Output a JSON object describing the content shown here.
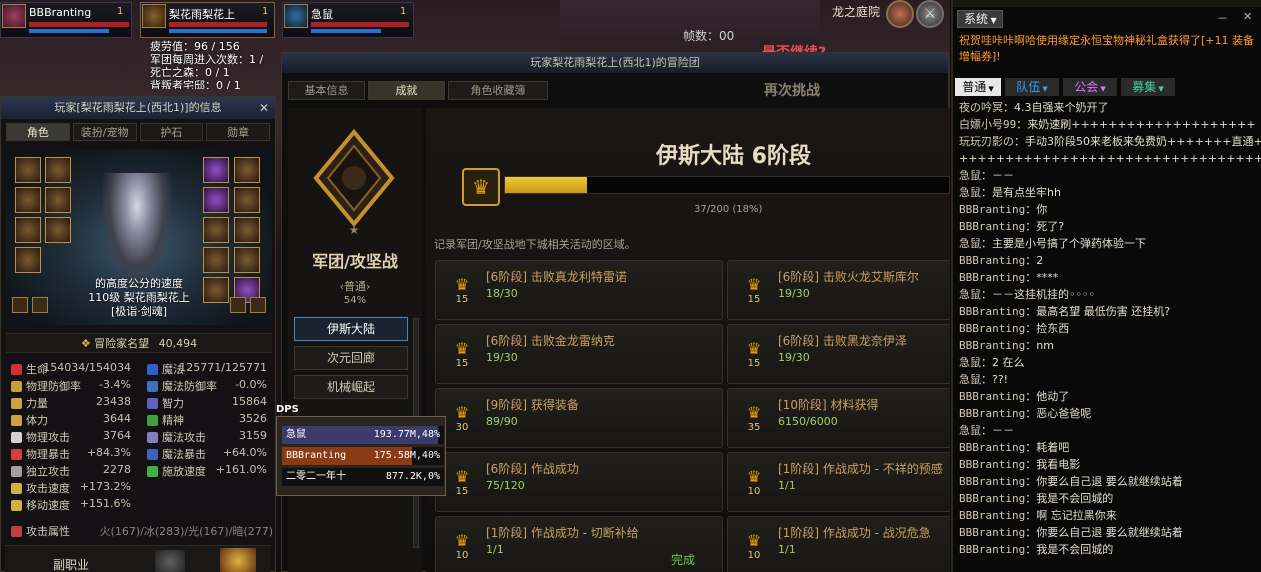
{
  "party": [
    {
      "name": "BBBranting",
      "count": "1"
    },
    {
      "name": "梨花雨梨花上",
      "count": "1"
    },
    {
      "name": "急鼠",
      "count": "1"
    }
  ],
  "location": "龙之庭院",
  "combo_label": "帧数：",
  "combo_value": "00",
  "overlay_text": "是否继续?",
  "fatigue": {
    "lines": [
      "疲劳值：96 / 156",
      "军团每周进入次数：1 /",
      "死亡之森：0 / 1",
      "背叛者宅邸：0 / 1"
    ]
  },
  "char_panel": {
    "title": "玩家[梨花雨梨花上(西北1)]的信息",
    "close": "✕",
    "tabs": [
      "角色",
      "装扮/宠物",
      "护石",
      "勋章"
    ],
    "avatar_lines": [
      "的高度公分的速度",
      "110级 梨花雨梨花上",
      "[极诣·剑魂]"
    ],
    "fame_label": "冒险家名望",
    "fame_value": "40,494",
    "stats_left": [
      {
        "label": "生命",
        "value": "154034/154034",
        "color": "#d03030"
      },
      {
        "label": "物理防御率",
        "value": "-3.4%",
        "color": "#c0a040"
      },
      {
        "label": "力量",
        "value": "23438",
        "color": "#d0a040"
      },
      {
        "label": "体力",
        "value": "3644",
        "color": "#d0a040"
      },
      {
        "label": "物理攻击",
        "value": "3764",
        "color": "#d0d0d0"
      },
      {
        "label": "物理暴击",
        "value": "+84.3%",
        "color": "#d04040"
      },
      {
        "label": "独立攻击",
        "value": "2278",
        "color": "#a0a0a0"
      },
      {
        "label": "攻击速度",
        "value": "+173.2%",
        "color": "#d0b040"
      },
      {
        "label": "移动速度",
        "value": "+151.6%",
        "color": "#d0b040"
      }
    ],
    "stats_right": [
      {
        "label": "魔法",
        "value": "125771/125771",
        "color": "#3060d0"
      },
      {
        "label": "魔法防御率",
        "value": "-0.0%",
        "color": "#4070c0"
      },
      {
        "label": "智力",
        "value": "15864",
        "color": "#6060c0"
      },
      {
        "label": "精神",
        "value": "3526",
        "color": "#40a040"
      },
      {
        "label": "魔法攻击",
        "value": "3159",
        "color": "#8080c0"
      },
      {
        "label": "魔法暴击",
        "value": "+64.0%",
        "color": "#4060c0"
      },
      {
        "label": "施放速度",
        "value": "+161.0%",
        "color": "#40b040"
      }
    ],
    "attr_label": "攻击属性",
    "attr_value": "火(167)/冰(283)/光(167)/暗(277)",
    "sub_job": "副职业"
  },
  "adv_panel": {
    "title": "玩家梨花雨梨花上(西北1)的冒险团",
    "tabs": [
      "基本信息",
      "成就",
      "角色收藏簿"
    ],
    "left_title": "军团/攻坚战",
    "left_grade": "‹普通›",
    "left_percent": "54%",
    "categories": [
      "伊斯大陆",
      "次元回廊",
      "机械崛起"
    ],
    "retry_text": "再次挑战",
    "stage_title": "伊斯大陆 6阶段",
    "progress_text": "37/200 (18%)",
    "progress_fraction": 0.185,
    "description": "记录军团/攻坚战地下城相关活动的区域。",
    "achievements": [
      {
        "name": "[6阶段] 击败真龙利特雷诺",
        "progress": "18/30",
        "level": "15",
        "done": ""
      },
      {
        "name": "[6阶段] 击败火龙艾斯库尔",
        "progress": "19/30",
        "level": "15",
        "done": ""
      },
      {
        "name": "[6阶段] 击败金龙雷纳克",
        "progress": "19/30",
        "level": "15",
        "done": ""
      },
      {
        "name": "[6阶段] 击败黑龙奈伊泽",
        "progress": "19/30",
        "level": "15",
        "done": ""
      },
      {
        "name": "[9阶段] 获得装备",
        "progress": "89/90",
        "level": "30",
        "done": ""
      },
      {
        "name": "[10阶段] 材料获得",
        "progress": "6150/6000",
        "level": "35",
        "done": ""
      },
      {
        "name": "[6阶段] 作战成功",
        "progress": "75/120",
        "level": "15",
        "done": ""
      },
      {
        "name": "[1阶段] 作战成功 - 不祥的预感",
        "progress": "1/1",
        "level": "10",
        "done": ""
      },
      {
        "name": "[1阶段] 作战成功 - 切断补给",
        "progress": "1/1",
        "level": "10",
        "done": "完成"
      },
      {
        "name": "[1阶段] 作战成功 - 战况危急",
        "progress": "1/1",
        "level": "10",
        "done": ""
      }
    ]
  },
  "dps": {
    "label": "DPS",
    "rows": [
      {
        "name": "急鼠",
        "value": "193.77M,48%",
        "fraction": 0.48,
        "color": "#3a3c6c"
      },
      {
        "name": "BBBranting",
        "value": "175.58M,40%",
        "fraction": 0.4,
        "color": "#8a3a14"
      },
      {
        "name": "二零二一年十",
        "value": "877.2K,0%",
        "fraction": 0.0,
        "color": "#1a1a1a"
      }
    ]
  },
  "chat": {
    "system_tab": "系统",
    "notice": "祝贺哇咔咔啊哈使用缘定永恒宝物神秘礼盒获得了[+11 装备增幅券]!",
    "tabs": [
      "普通",
      "队伍",
      "公会",
      "募集"
    ],
    "messages": [
      {
        "who": "夜の吟冥",
        "text": "：4.3自强来个奶开了"
      },
      {
        "who": "白嫖小号99",
        "text": "：来奶速刷++++++++++++++++++++"
      },
      {
        "who": "玩玩刃影の",
        "text": "：手动3阶段50来老板来免费奶+++++++直通++"
      },
      {
        "who": "",
        "text": "    ++++++++++++++++++++++++++++++++++++3=1+"
      },
      {
        "who": "急鼠",
        "text": "：－－"
      },
      {
        "who": "急鼠",
        "text": "：是有点坐牢hh"
      },
      {
        "who": "BBBranting",
        "text": "：你"
      },
      {
        "who": "BBBranting",
        "text": "：死了?"
      },
      {
        "who": "急鼠",
        "text": "：主要是小号搞了个弹药体验一下"
      },
      {
        "who": "BBBranting",
        "text": "：2"
      },
      {
        "who": "BBBranting",
        "text": "：****"
      },
      {
        "who": "急鼠",
        "text": "：－－这挂机挂的◦◦◦◦"
      },
      {
        "who": "BBBranting",
        "text": "：最高名望 最低伤害 还挂机?"
      },
      {
        "who": "BBBranting",
        "text": "：捡东西"
      },
      {
        "who": "BBBranting",
        "text": "：nm"
      },
      {
        "who": "急鼠",
        "text": "：2 在么"
      },
      {
        "who": "急鼠",
        "text": "：??!"
      },
      {
        "who": "BBBranting",
        "text": "：他动了"
      },
      {
        "who": "BBBranting",
        "text": "：恶心爸爸呢"
      },
      {
        "who": "急鼠",
        "text": "：－－"
      },
      {
        "who": "BBBranting",
        "text": "：耗着吧"
      },
      {
        "who": "BBBranting",
        "text": "：我看电影"
      },
      {
        "who": "BBBranting",
        "text": "：你要么自己退 要么就继续站着"
      },
      {
        "who": "BBBranting",
        "text": "：我是不会回城的"
      },
      {
        "who": "BBBranting",
        "text": "：啊 忘记拉黑你来"
      },
      {
        "who": "BBBranting",
        "text": "：你要么自己退 要么就继续站着"
      },
      {
        "who": "BBBranting",
        "text": "：我是不会回城的"
      }
    ]
  }
}
